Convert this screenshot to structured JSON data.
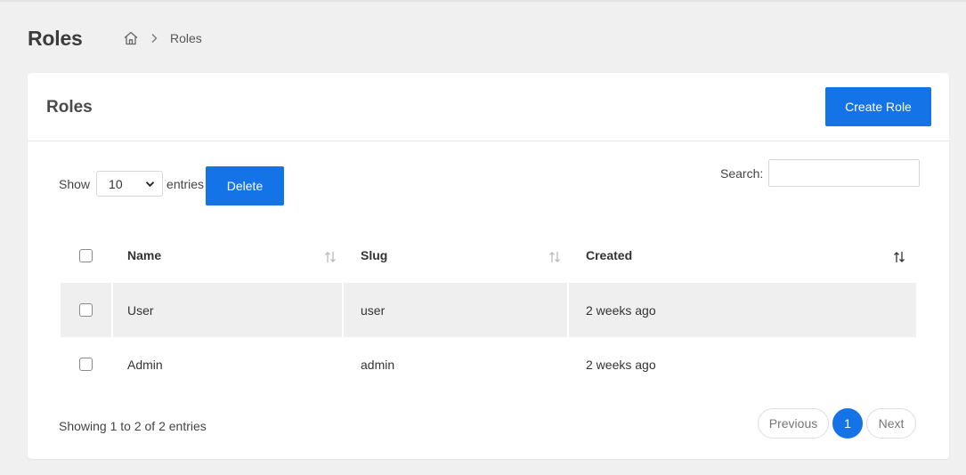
{
  "page": {
    "title": "Roles",
    "breadcrumb": {
      "home_icon": "home-icon",
      "separator_icon": "chevron-right-icon",
      "current": "Roles"
    }
  },
  "card": {
    "title": "Roles",
    "create_button": "Create Role"
  },
  "controls": {
    "show_label": "Show",
    "page_length": "10",
    "entries_label": "entries",
    "delete_button": "Delete",
    "search_label": "Search:",
    "search_value": ""
  },
  "table": {
    "columns": [
      "Name",
      "Slug",
      "Created"
    ],
    "rows": [
      {
        "name": "User",
        "slug": "user",
        "created": "2 weeks ago"
      },
      {
        "name": "Admin",
        "slug": "admin",
        "created": "2 weeks ago"
      }
    ]
  },
  "footer": {
    "info": "Showing 1 to 2 of 2 entries",
    "prev": "Previous",
    "current_page": "1",
    "next": "Next"
  },
  "colors": {
    "accent": "#1473e6",
    "background": "#f0f0f0",
    "row_shade": "#efefef"
  }
}
